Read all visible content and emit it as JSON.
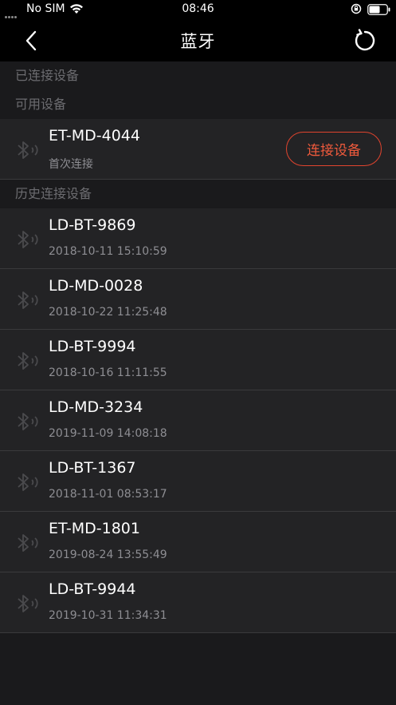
{
  "status_bar": {
    "carrier": "No SIM",
    "time": "08:46"
  },
  "nav": {
    "title": "蓝牙",
    "back_icon": "chevron-left-icon",
    "refresh_icon": "refresh-icon"
  },
  "sections": {
    "connected": "已连接设备",
    "available": "可用设备",
    "history": "历史连接设备"
  },
  "available_devices": [
    {
      "name": "ET-MD-4044",
      "sub": "首次连接",
      "action": "连接设备"
    }
  ],
  "history_devices": [
    {
      "name": "LD-BT-9869",
      "time": "2018-10-11 15:10:59"
    },
    {
      "name": "LD-MD-0028",
      "time": "2018-10-22 11:25:48"
    },
    {
      "name": "LD-BT-9994",
      "time": "2018-10-16 11:11:55"
    },
    {
      "name": "LD-MD-3234",
      "time": "2019-11-09 14:08:18"
    },
    {
      "name": "LD-BT-1367",
      "time": "2018-11-01 08:53:17"
    },
    {
      "name": "ET-MD-1801",
      "time": "2019-08-24 13:55:49"
    },
    {
      "name": "LD-BT-9944",
      "time": "2019-10-31 11:34:31"
    }
  ],
  "colors": {
    "accent": "#ef5a3c",
    "background": "#1a1a1c",
    "row": "#232325"
  }
}
